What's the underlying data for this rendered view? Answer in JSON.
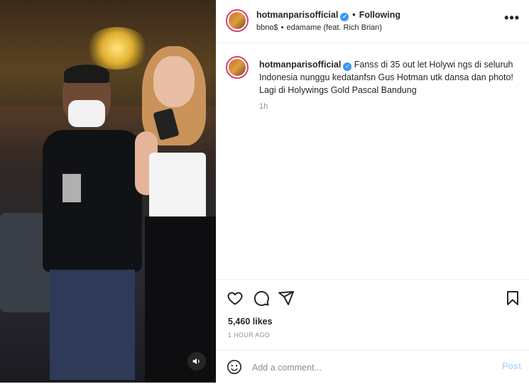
{
  "header": {
    "username": "hotmanparisofficial",
    "follow_status": "Following",
    "audio_artist": "bbno$",
    "audio_track": "edamame (feat. Rich Brian)",
    "verified_icon": "verified-badge-icon",
    "more_icon": "more-options-icon"
  },
  "caption": {
    "username": "hotmanparisofficial",
    "text": "Fanss di 35 out let Holywi ngs di seluruh Indonesia nunggu kedatanfsn Gus Hotman utk dansa dan photo! Lagi di Holywings Gold Pascal Bandung",
    "time": "1h"
  },
  "actions": {
    "like_icon": "heart-icon",
    "comment_icon": "comment-icon",
    "share_icon": "share-icon",
    "save_icon": "bookmark-icon"
  },
  "likes": "5,460 likes",
  "posted_ago": "1 HOUR AGO",
  "comment": {
    "placeholder": "Add a comment...",
    "post_label": "Post",
    "emoji_icon": "emoji-icon"
  },
  "media": {
    "audio_toggle_icon": "speaker-icon"
  },
  "colors": {
    "verified": "#3897f0",
    "post_button": "#b3dbff",
    "story_ring": "#d63c7a",
    "muted_text": "#8e8e8e"
  }
}
